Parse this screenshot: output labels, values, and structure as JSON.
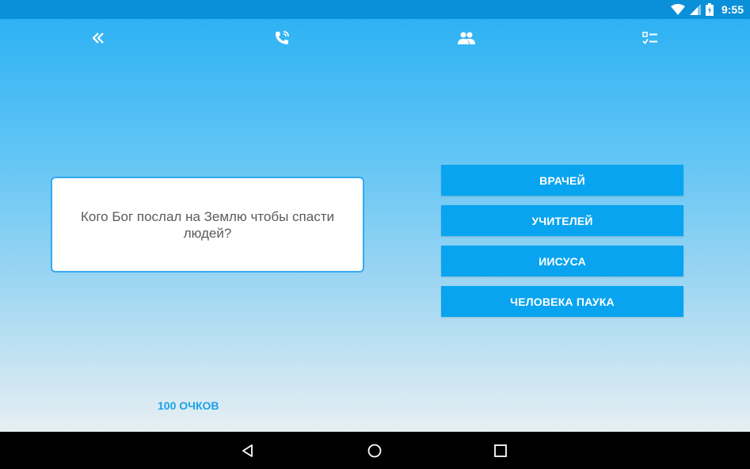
{
  "status_bar": {
    "time": "9:55",
    "icons": [
      "wifi-icon",
      "cell-signal-icon",
      "battery-charging-icon"
    ]
  },
  "toolbar": {
    "icons": [
      "double-chevron-left-icon",
      "phone-call-icon",
      "people-icon",
      "checklist-icon"
    ]
  },
  "question": {
    "text": "Кого Бог послал на Землю чтобы спасти людей?"
  },
  "answers": [
    {
      "label": "ВРАЧЕЙ"
    },
    {
      "label": "УЧИТЕЛЕЙ"
    },
    {
      "label": "ИИСУСА"
    },
    {
      "label": "ЧЕЛОВЕКА ПАУКА"
    }
  ],
  "score": {
    "label": "100 ОЧКОВ"
  },
  "nav_bar": {
    "icons": [
      "back-icon",
      "home-icon",
      "recents-icon"
    ]
  },
  "colors": {
    "status_bar": "#0a90d8",
    "answer_button": "#08a4ef",
    "card_border": "#35aaf0",
    "score_text": "#1aa2e6"
  }
}
